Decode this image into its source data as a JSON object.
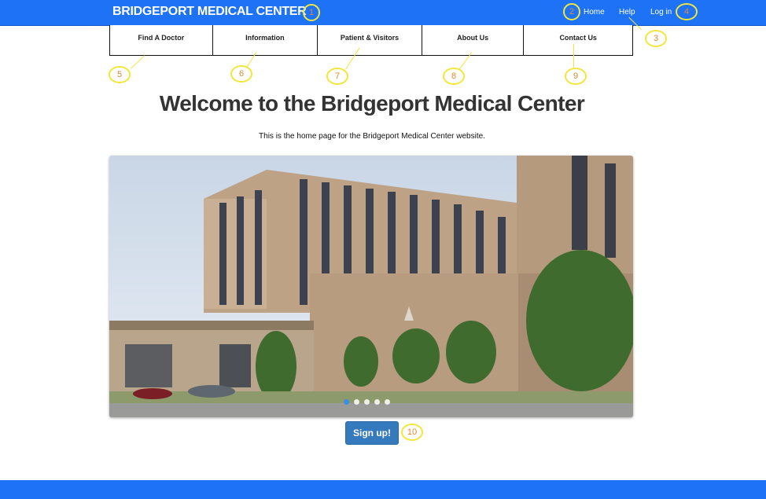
{
  "header": {
    "brand": "BRIDGEPORT MEDICAL CENTER",
    "links": {
      "home": "Home",
      "help": "Help",
      "login": "Log in"
    }
  },
  "nav": {
    "items": [
      {
        "label": "Find A Doctor"
      },
      {
        "label": "Information"
      },
      {
        "label": "Patient & Visitors"
      },
      {
        "label": "About Us"
      },
      {
        "label": "Contact Us"
      }
    ]
  },
  "main": {
    "title": "Welcome to the Bridgeport Medical Center",
    "subtitle": "This is the home page for the Bridgeport Medical Center website.",
    "carousel": {
      "slide_count": 5,
      "active_index": 0
    },
    "signup_label": "Sign up!"
  },
  "annotations": [
    "1",
    "2",
    "3",
    "4",
    "5",
    "6",
    "7",
    "8",
    "9",
    "10"
  ],
  "colors": {
    "primary": "#1d72f5",
    "button": "#357abd",
    "annotation_ring": "#f2e63a",
    "annotation_text": "#e08a32"
  }
}
